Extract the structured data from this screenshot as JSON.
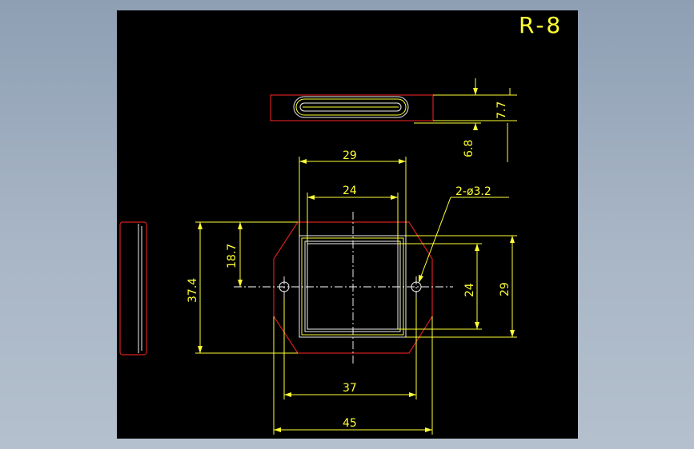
{
  "drawing": {
    "title": "R-8",
    "dimensions": {
      "side_height": "7.7",
      "side_thickness": "6.8",
      "outer_width_top": "29",
      "inner_width_top": "24",
      "hole_callout": "2-ø3.2",
      "hole_offset": "18.7",
      "overall_height": "37.4",
      "inner_height_right": "24",
      "outer_height_right": "29",
      "hole_spacing": "37",
      "overall_width": "45"
    },
    "colors": {
      "background": "#000000",
      "outline": "#d42020",
      "dimension": "#ffff33",
      "centerline": "#ffffff"
    }
  }
}
